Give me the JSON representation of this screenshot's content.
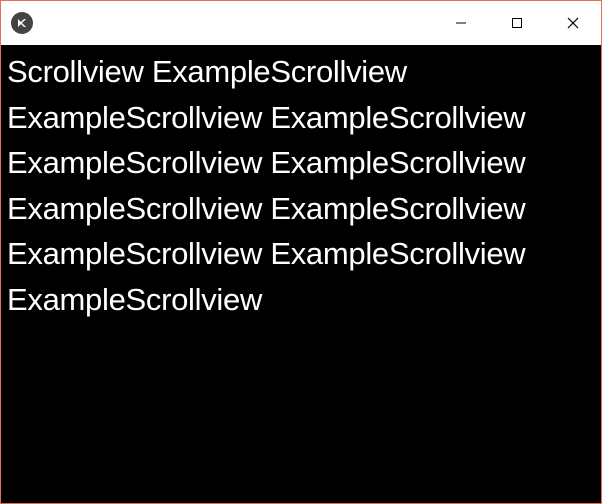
{
  "window": {
    "title": ""
  },
  "content": {
    "text": "Scrollview ExampleScrollview ExampleScrollview ExampleScrollview ExampleScrollview ExampleScrollview ExampleScrollview ExampleScrollview ExampleScrollview ExampleScrollview ExampleScrollview"
  },
  "icons": {
    "app": "kivy-icon",
    "minimize": "minimize-icon",
    "maximize": "maximize-icon",
    "close": "close-icon"
  }
}
